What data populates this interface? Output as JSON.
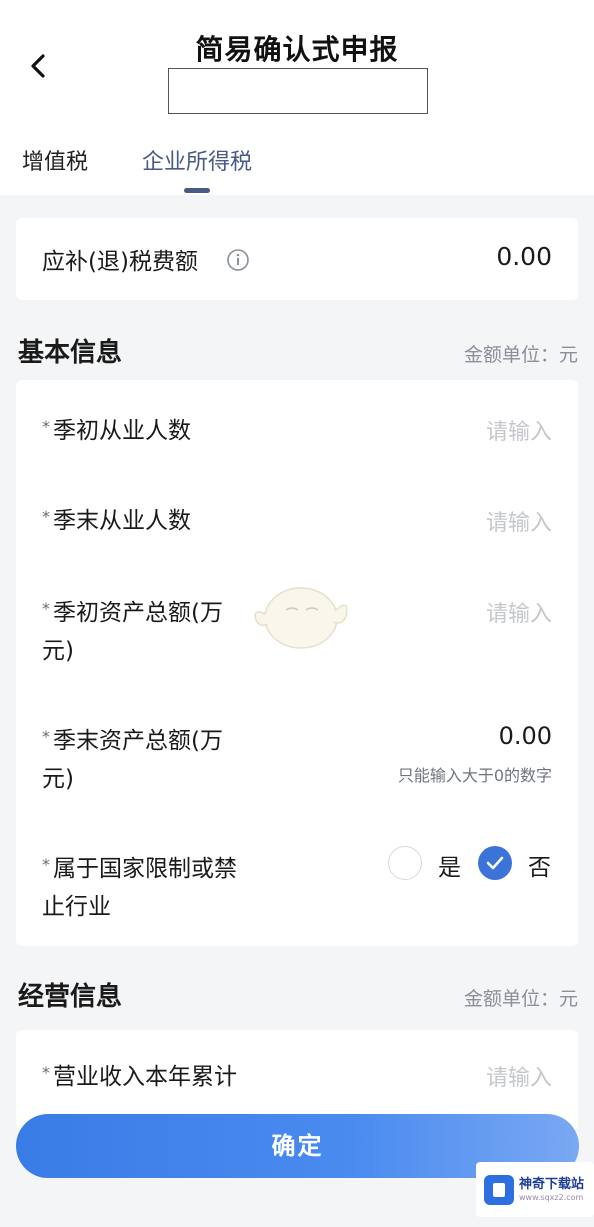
{
  "header": {
    "title": "简易确认式申报",
    "back_icon": "chevron-left-icon"
  },
  "tabs": [
    {
      "label": "增值税",
      "active": false
    },
    {
      "label": "企业所得税",
      "active": true
    }
  ],
  "tax_summary": {
    "label": "应补(退)税费额",
    "info_icon": "info-icon",
    "value": "0.00"
  },
  "basic_info": {
    "title": "基本信息",
    "unit": "金额单位：元",
    "fields": [
      {
        "label": "季初从业人数",
        "placeholder": "请输入"
      },
      {
        "label": "季末从业人数",
        "placeholder": "请输入"
      },
      {
        "label_line1": "季初资产总额(万",
        "label_line2": "元)",
        "placeholder": "请输入"
      },
      {
        "label_line1": "季末资产总额(万",
        "label_line2": "元)",
        "value": "0.00",
        "hint": "只能输入大于0的数字"
      },
      {
        "label_line1": "属于国家限制或禁",
        "label_line2": "止行业",
        "option_yes": "是",
        "option_no": "否",
        "selected": "否"
      }
    ]
  },
  "business_info": {
    "title": "经营信息",
    "unit": "金额单位：元",
    "fields": [
      {
        "label": "营业收入本年累计",
        "placeholder": "请输入"
      }
    ]
  },
  "confirm_button": "确定",
  "watermark": {
    "text": "神奇下载站",
    "sub": "www.sqxz2.com"
  },
  "colors": {
    "accent": "#3b73d9",
    "tab_active": "#4a5a86",
    "placeholder": "#c4c7cc"
  }
}
